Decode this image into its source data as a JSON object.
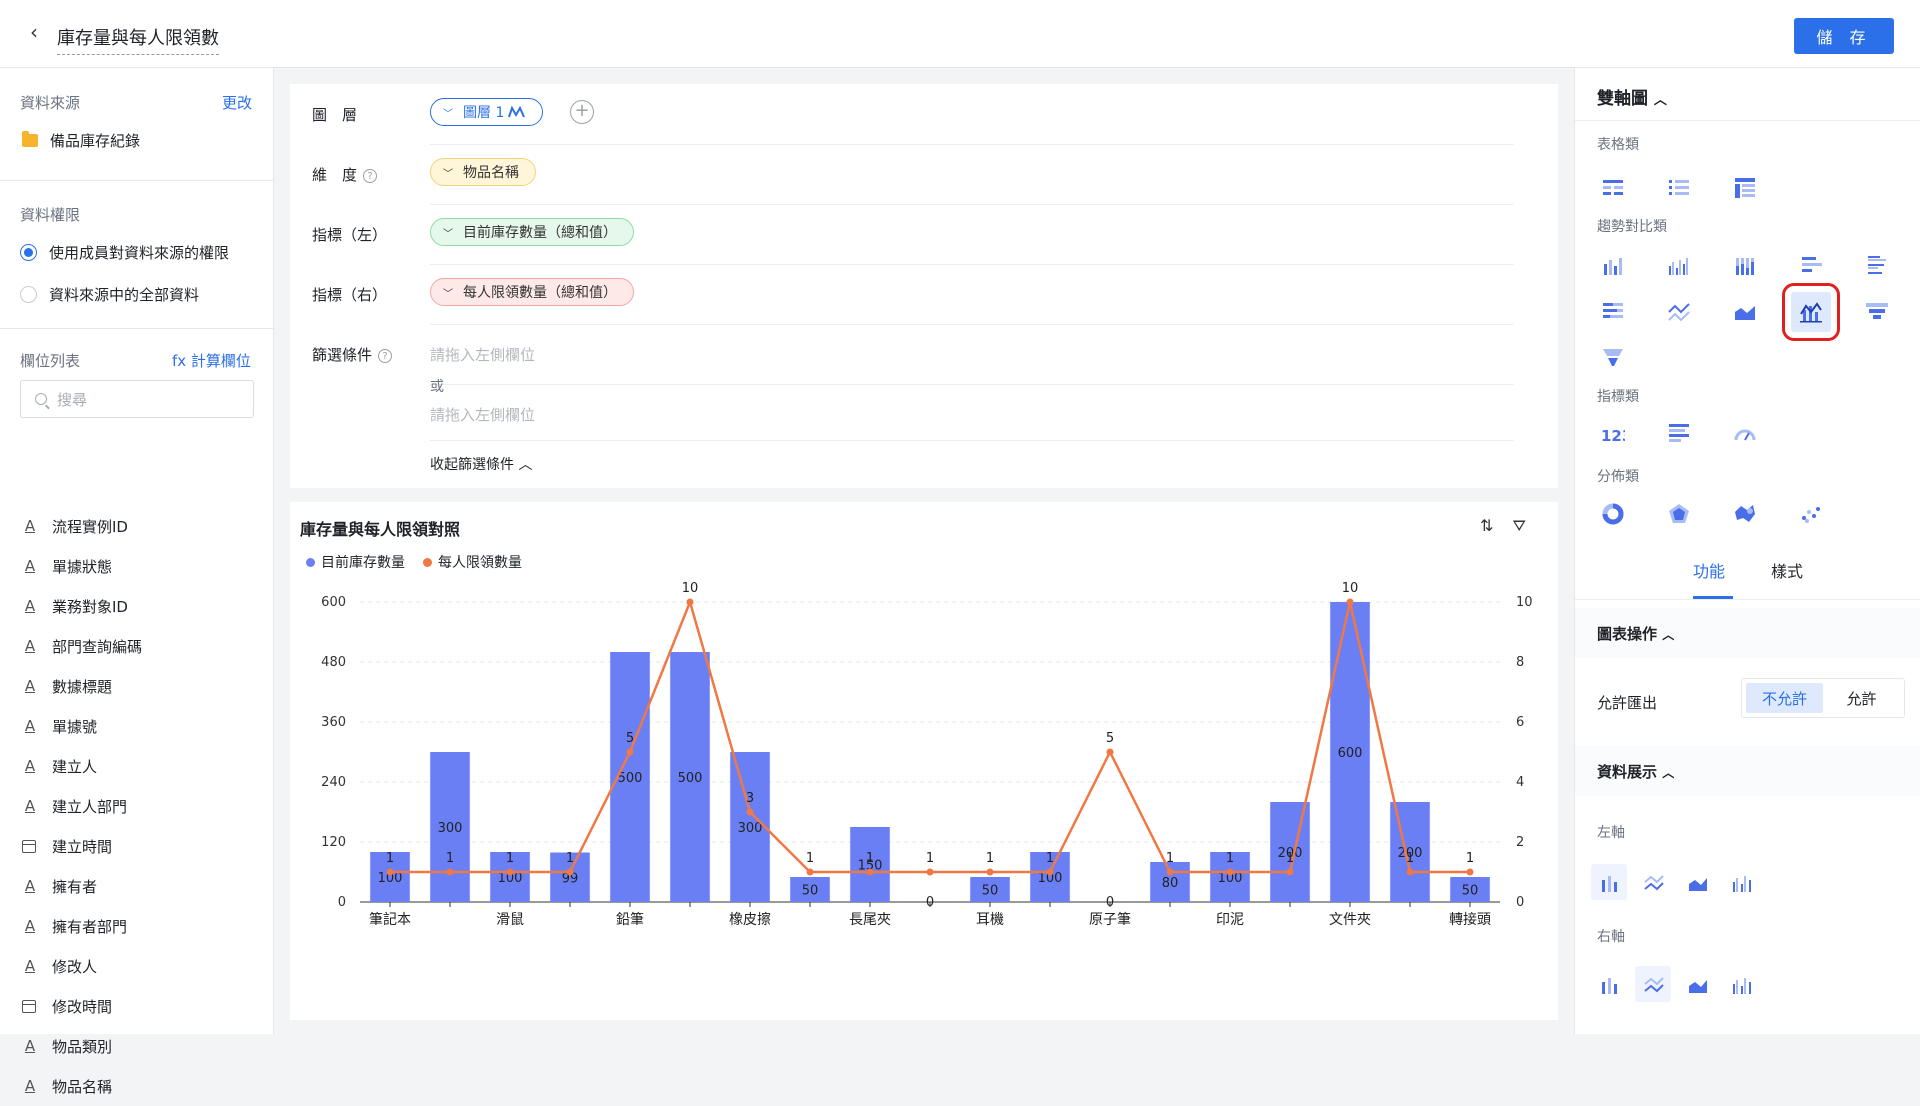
{
  "header": {
    "title": "庫存量與每人限領數",
    "save_label": "儲 存"
  },
  "left_panel": {
    "source_label": "資料來源",
    "source_change": "更改",
    "source_name": "備品庫存紀錄",
    "permission_label": "資料權限",
    "permission_options": [
      "使用成員對資料來源的權限",
      "資料來源中的全部資料"
    ],
    "fields_label": "欄位列表",
    "calc_field": "fx 計算欄位",
    "search_placeholder": "搜尋",
    "fields": [
      {
        "name": "流程實例ID",
        "type": "text"
      },
      {
        "name": "單據狀態",
        "type": "text"
      },
      {
        "name": "業務對象ID",
        "type": "text"
      },
      {
        "name": "部門查詢編碼",
        "type": "text"
      },
      {
        "name": "數據標題",
        "type": "text"
      },
      {
        "name": "單據號",
        "type": "text"
      },
      {
        "name": "建立人",
        "type": "text"
      },
      {
        "name": "建立人部門",
        "type": "text"
      },
      {
        "name": "建立時間",
        "type": "date"
      },
      {
        "name": "擁有者",
        "type": "text"
      },
      {
        "name": "擁有者部門",
        "type": "text"
      },
      {
        "name": "修改人",
        "type": "text"
      },
      {
        "name": "修改時間",
        "type": "date"
      },
      {
        "name": "物品類別",
        "type": "text"
      },
      {
        "name": "物品名稱",
        "type": "text"
      }
    ]
  },
  "config": {
    "layer_label": "圖　層",
    "layer_pill": "圖層 1",
    "dimension_label": "維　度",
    "dimension_pill": "物品名稱",
    "metric_left_label": "指標（左）",
    "metric_left_pill": "目前庫存數量（總和值）",
    "metric_right_label": "指標（右）",
    "metric_right_pill": "每人限領數量（總和值）",
    "filter_label": "篩選條件",
    "filter_placeholder": "請拖入左側欄位",
    "or_text": "或",
    "collapse_filter": "收起篩選條件"
  },
  "chart_data": {
    "type": "bar",
    "title": "庫存量與每人限領對照",
    "categories": [
      "筆記本",
      "",
      "滑鼠",
      "",
      "鉛筆",
      "",
      "橡皮擦",
      "",
      "長尾夾",
      "",
      "耳機",
      "",
      "原子筆",
      "",
      "印泥",
      "",
      "文件夾",
      "",
      "轉接頭"
    ],
    "category_labels_full": [
      "筆記本",
      "",
      "滑鼠",
      "",
      "鉛筆",
      "",
      "橡皮擦",
      "",
      "長尾夾",
      "",
      "耳機",
      "",
      "原子筆",
      "",
      "印泥",
      "",
      "文件夾",
      "",
      "轉接頭"
    ],
    "series": [
      {
        "name": "目前庫存數量",
        "type": "bar",
        "axis": "left",
        "color": "#6b7ff5",
        "values": [
          100,
          300,
          100,
          99,
          500,
          500,
          300,
          50,
          150,
          0,
          50,
          100,
          0,
          80,
          100,
          200,
          600,
          200,
          50
        ]
      },
      {
        "name": "每人限領數量",
        "type": "line",
        "axis": "right",
        "color": "#f07844",
        "values": [
          1,
          1,
          1,
          1,
          5,
          10,
          3,
          1,
          1,
          1,
          1,
          1,
          5,
          1,
          1,
          1,
          10,
          1,
          1
        ]
      }
    ],
    "left_axis": {
      "ylim": [
        0,
        600
      ],
      "ticks": [
        0,
        120,
        240,
        360,
        480,
        600
      ]
    },
    "right_axis": {
      "ylim": [
        0,
        10
      ],
      "ticks": [
        0,
        2,
        4,
        6,
        8,
        10
      ]
    },
    "legend": "top-left",
    "grid": true
  },
  "right_panel": {
    "chart_type_title": "雙軸圖",
    "groups": {
      "table": "表格類",
      "trend": "趨勢對比類",
      "metric": "指標類",
      "dist": "分佈類"
    },
    "tabs": [
      "功能",
      "樣式"
    ],
    "chart_ops_title": "圖表操作",
    "allow_export_label": "允許匯出",
    "export_options": [
      "不允許",
      "允許"
    ],
    "data_display_title": "資料展示",
    "left_axis_label": "左軸",
    "right_axis_label": "右軸",
    "selected_icon": "dual-axis-chart-icon"
  }
}
